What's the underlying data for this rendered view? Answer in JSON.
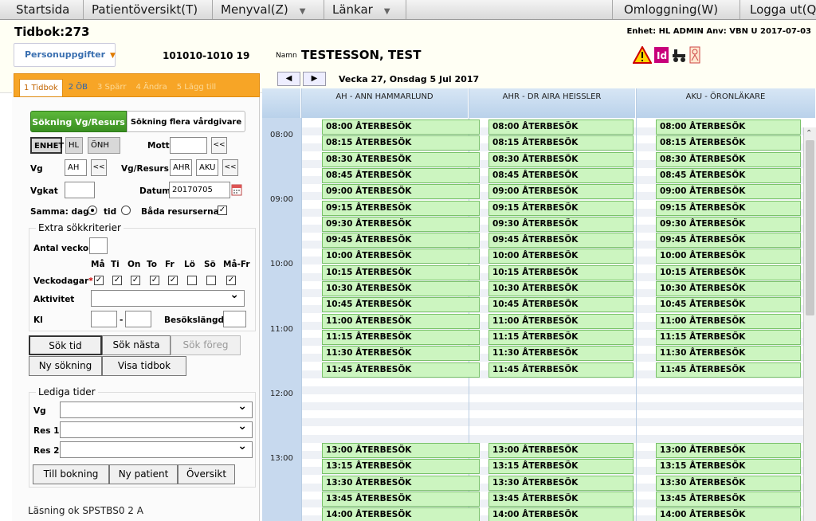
{
  "menu": {
    "items": [
      "Startsida",
      "Patientöversikt(T)",
      "Menyval(Z)",
      "Länkar"
    ],
    "right": [
      "Omloggning(W)",
      "Logga ut(Q"
    ]
  },
  "header": {
    "title": "Tidbok:273",
    "unit_info": "Enhet: HL ADMIN Anv: VBN  U  2017-07-03",
    "personal_btn": "Personuppgifter",
    "pnr": "101010-1010 19",
    "name_label": "Namn",
    "patient_name": "TESTESSON, TEST"
  },
  "tabs": [
    "1 Tidbok",
    "2 ÖB",
    "3 Spärr",
    "4 Ändra",
    "5 Lägg till"
  ],
  "search": {
    "btn_vg": "Sökning Vg/Resurs",
    "btn_multi": "Sökning flera vårdgivare",
    "enhet": "ENHET",
    "hl": "HL",
    "onh": "ÖNH",
    "mott_label": "Mott",
    "vg_label": "Vg",
    "vg_value": "AH",
    "vgres_label": "Vg/Resurs",
    "vgres_1": "AHR",
    "vgres_2": "AKU",
    "vgkat_label": "Vgkat",
    "datum_label": "Datum",
    "datum_value": "20170705",
    "samma_label": "Samma: dag",
    "tid_label": "tid",
    "bada_label": "Båda resurserna",
    "extra_label": "Extra sökkriterier",
    "antal_label": "Antal veckor",
    "weekdays": [
      "Må",
      "Ti",
      "On",
      "To",
      "Fr",
      "Lö",
      "Sö",
      "Må-Fr"
    ],
    "weekday_checked": [
      true,
      true,
      true,
      true,
      true,
      false,
      false,
      true
    ],
    "veckodagar_label": "Veckodagar",
    "aktivitet_label": "Aktivitet",
    "kl_label": "Kl",
    "besok_label": "Besökslängd",
    "btn_sok": "Sök tid",
    "btn_nasta": "Sök nästa",
    "btn_foreg": "Sök föreg",
    "btn_ny": "Ny sökning",
    "btn_visa": "Visa tidbok"
  },
  "lediga": {
    "label": "Lediga tider",
    "vg": "Vg",
    "res1": "Res 1",
    "res2": "Res 2",
    "btn_bokning": "Till bokning",
    "btn_patient": "Ny patient",
    "btn_oversikt": "Översikt"
  },
  "status": "Läsning ok SPSTBS0 2 A",
  "calendar": {
    "week_label": "Vecka 27, Onsdag 5 Jul 2017",
    "columns": [
      "AH - ANN HAMMARLUND",
      "AHR - DR AIRA HEISSLER",
      "AKU - ÖRONLÄKARE"
    ],
    "hours": [
      "08:00",
      "09:00",
      "10:00",
      "11:00",
      "12:00",
      "13:00"
    ],
    "slots": [
      "08:00 ÅTERBESÖK",
      "08:15 ÅTERBESÖK",
      "08:30 ÅTERBESÖK",
      "08:45 ÅTERBESÖK",
      "09:00 ÅTERBESÖK",
      "09:15 ÅTERBESÖK",
      "09:30 ÅTERBESÖK",
      "09:45 ÅTERBESÖK",
      "10:00 ÅTERBESÖK",
      "10:15 ÅTERBESÖK",
      "10:30 ÅTERBESÖK",
      "10:45 ÅTERBESÖK",
      "11:00 ÅTERBESÖK",
      "11:15 ÅTERBESÖK",
      "11:30 ÅTERBESÖK",
      "11:45 ÅTERBESÖK"
    ],
    "afternoon_slots": [
      "13:00 ÅTERBESÖK",
      "13:15 ÅTERBESÖK",
      "13:30 ÅTERBESÖK",
      "13:45 ÅTERBESÖK",
      "14:00 ÅTERBESÖK"
    ]
  },
  "colors": {
    "slot_bg": "#ccf5c0",
    "tab_orange": "#f7a526",
    "search_green": "#4aa42e",
    "header_blue": "#c7d9ee"
  }
}
